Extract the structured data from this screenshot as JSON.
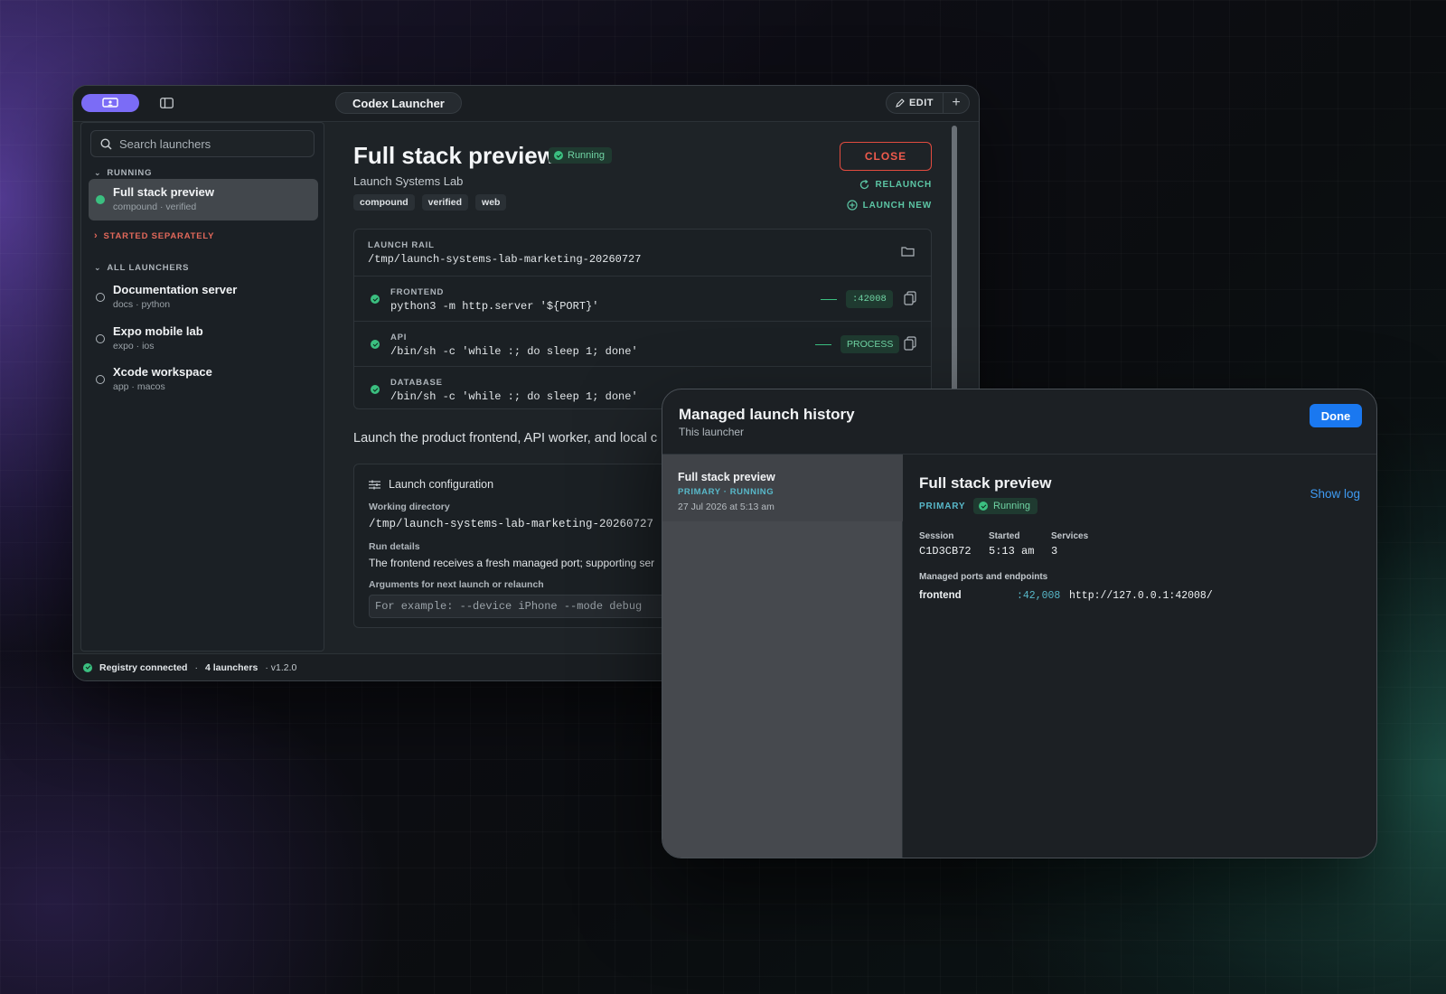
{
  "window": {
    "title": "Codex Launcher",
    "edit_label": "EDIT",
    "add_label": "+"
  },
  "sidebar": {
    "search_placeholder": "Search launchers",
    "running_header": "RUNNING",
    "started_separately_header": "STARTED SEPARATELY",
    "all_header": "ALL LAUNCHERS",
    "running_items": [
      {
        "title": "Full stack preview",
        "subtitle": "compound · verified",
        "status": "running"
      }
    ],
    "all_items": [
      {
        "title": "Documentation server",
        "subtitle": "docs · python"
      },
      {
        "title": "Expo mobile lab",
        "subtitle": "expo · ios"
      },
      {
        "title": "Xcode workspace",
        "subtitle": "app · macos"
      }
    ]
  },
  "detail": {
    "title": "Full stack preview",
    "status": "Running",
    "subtitle": "Launch Systems Lab",
    "tags": [
      "compound",
      "verified",
      "web"
    ],
    "close_label": "CLOSE",
    "relaunch_label": "RELAUNCH",
    "launch_new_label": "LAUNCH NEW",
    "rail": {
      "label": "LAUNCH RAIL",
      "path": "/tmp/launch-systems-lab-marketing-20260727",
      "services": [
        {
          "name": "FRONTEND",
          "command": "python3 -m http.server '${PORT}'",
          "chip": ":42008"
        },
        {
          "name": "API",
          "command": "/bin/sh -c 'while :; do sleep 1; done'",
          "chip": "PROCESS"
        },
        {
          "name": "DATABASE",
          "command": "/bin/sh -c 'while :; do sleep 1; done'",
          "chip": ""
        }
      ]
    },
    "description": "Launch the product frontend, API worker, and local c",
    "config": {
      "header": "Launch configuration",
      "working_dir_label": "Working directory",
      "working_dir": "/tmp/launch-systems-lab-marketing-20260727",
      "run_details_label": "Run details",
      "run_details": "The frontend receives a fresh managed port; supporting ser",
      "args_label": "Arguments for next launch or relaunch",
      "args_placeholder": "For example: --device iPhone --mode debug"
    }
  },
  "statusbar": {
    "registry": "Registry connected",
    "sep": "·",
    "launchers": "4 launchers",
    "version": "· v1.2.0"
  },
  "history": {
    "title": "Managed launch history",
    "subtitle": "This launcher",
    "done_label": "Done",
    "entries": [
      {
        "title": "Full stack preview",
        "meta": "PRIMARY · RUNNING",
        "date": "27 Jul 2026 at 5:13 am"
      }
    ],
    "selected": {
      "title": "Full stack preview",
      "role": "PRIMARY",
      "status": "Running",
      "show_log_label": "Show log",
      "session_label": "Session",
      "session": "C1D3CB72",
      "started_label": "Started",
      "started": "5:13 am",
      "services_label": "Services",
      "services": "3",
      "ports_label": "Managed ports and endpoints",
      "port_name": "frontend",
      "port_num": ":42,008",
      "port_url": "http://127.0.0.1:42008/"
    }
  },
  "colors": {
    "accent": "#7b6cf6",
    "running_green": "#3bbf80",
    "close_red": "#e24b3f",
    "teal": "#5cc6a5",
    "primary_blue": "#1a78f0"
  }
}
